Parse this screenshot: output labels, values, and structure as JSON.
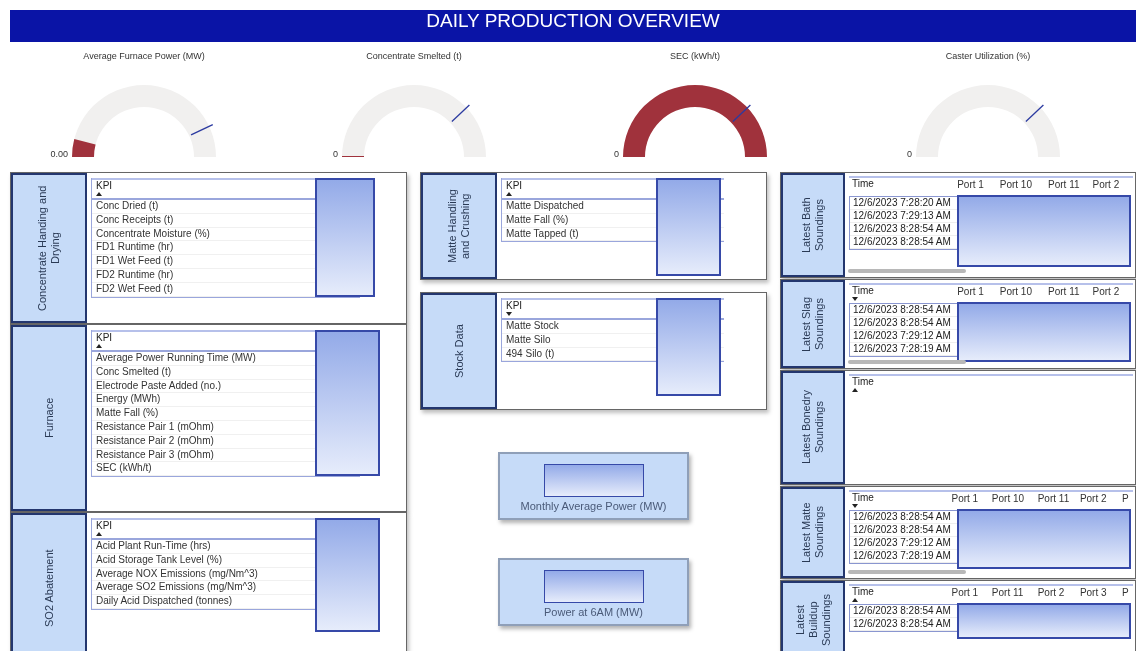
{
  "title": "DAILY PRODUCTION OVERVIEW",
  "gauges": [
    {
      "title": "Average Furnace Power (MW)",
      "min_label": "0.00"
    },
    {
      "title": "Concentrate Smelted (t)",
      "min_label": "0"
    },
    {
      "title": "SEC (kWh/t)",
      "min_label": "0"
    },
    {
      "title": "Caster Utilization (%)",
      "min_label": "0"
    }
  ],
  "left_panels": [
    {
      "label": "Concentrate Handing and Drying",
      "table": {
        "header": "KPI",
        "sorted": true,
        "descending": false,
        "rows": [
          "Conc Dried (t)",
          "Conc Receipts (t)",
          "Concentrate Moisture (%)",
          "FD1 Runtime (hr)",
          "FD1 Wet Feed (t)",
          "FD2 Runtime (hr)",
          "FD2 Wet Feed (t)"
        ]
      }
    },
    {
      "label": "Furnace",
      "table": {
        "header": "KPI",
        "sorted": true,
        "descending": false,
        "rows": [
          "Average Power Running Time (MW)",
          "Conc Smelted (t)",
          "Electrode Paste Added (no.)",
          "Energy (MWh)",
          "Matte Fall (%)",
          "Resistance Pair 1 (mOhm)",
          "Resistance Pair 2 (mOhm)",
          "Resistance Pair 3 (mOhm)",
          "SEC (kWh/t)"
        ]
      }
    },
    {
      "label": "SO2 Abatement",
      "table": {
        "header": "KPI",
        "sorted": true,
        "descending": false,
        "rows": [
          "Acid Plant Run-Time (hrs)",
          "Acid Storage Tank Level (%)",
          "Average NOX Emissions (mg/Nm^3)",
          "Average SO2 Emissions (mg/Nm^3)",
          "Daily Acid Dispatched (tonnes)"
        ]
      }
    }
  ],
  "middle_panels": [
    {
      "label": "Matte Handling and Crushing",
      "table": {
        "header": "KPI",
        "sorted": true,
        "descending": false,
        "rows": [
          "Matte Dispatched",
          "Matte Fall (%)",
          "Matte Tapped (t)"
        ]
      }
    },
    {
      "label": "Stock Data",
      "table": {
        "header": "KPI",
        "sorted": true,
        "descending": true,
        "rows": [
          "Matte Stock",
          "Matte Silo",
          "494 Silo (t)"
        ]
      }
    }
  ],
  "cards": [
    {
      "label": "Monthly Average Power (MW)"
    },
    {
      "label": "Power at 6AM (MW)"
    }
  ],
  "soundings": [
    {
      "label": "Latest Bath Soundings",
      "scrollbar": true,
      "table": {
        "sorted": false,
        "columns": [
          "Time",
          "Port 1",
          "Port 10",
          "Port 11",
          "Port 2"
        ],
        "rows": [
          "12/6/2023 7:28:20 AM",
          "12/6/2023 7:29:13 AM",
          "12/6/2023 8:28:54 AM",
          "12/6/2023 8:28:54 AM"
        ]
      }
    },
    {
      "label": "Latest Slag Soundings",
      "scrollbar": true,
      "table": {
        "sorted": true,
        "descending": true,
        "columns": [
          "Time",
          "Port 1",
          "Port 10",
          "Port 11",
          "Port 2"
        ],
        "rows": [
          "12/6/2023 8:28:54 AM",
          "12/6/2023 8:28:54 AM",
          "12/6/2023 7:29:12 AM",
          "12/6/2023 7:28:19 AM"
        ]
      }
    },
    {
      "label": "Latest Bonedry Soundings",
      "scrollbar": false,
      "table": {
        "sorted": true,
        "descending": false,
        "columns": [
          "Time"
        ]
      }
    },
    {
      "label": "Latest Matte Soundings",
      "scrollbar": true,
      "table": {
        "sorted": true,
        "descending": true,
        "columns": [
          "Time",
          "Port 1",
          "Port 10",
          "Port 11",
          "Port 2",
          "P"
        ],
        "rows": [
          "12/6/2023 8:28:54 AM",
          "12/6/2023 8:28:54 AM",
          "12/6/2023 7:29:12 AM",
          "12/6/2023 7:28:19 AM"
        ]
      }
    },
    {
      "label": "Latest Buildup Soundings",
      "scrollbar": false,
      "table": {
        "sorted": true,
        "descending": false,
        "columns": [
          "Time",
          "Port 1",
          "Port 11",
          "Port 2",
          "Port 3",
          "P"
        ],
        "rows": [
          "12/6/2023 8:28:54 AM",
          "12/6/2023 8:28:54 AM"
        ]
      }
    }
  ]
}
